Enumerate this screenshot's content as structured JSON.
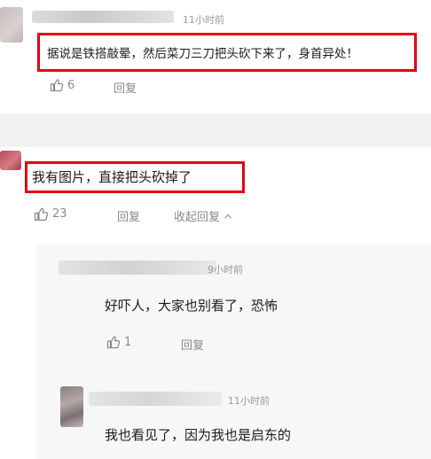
{
  "comment1": {
    "time": "11小时前",
    "text": "据说是铁搭敲晕，然后菜刀三刀把头砍下来了，身首异处！",
    "likes": "6",
    "reply_label": "回复"
  },
  "comment2": {
    "text": "我有图片，直接把头砍掉了",
    "likes": "23",
    "reply_label": "回复",
    "collapse_label": "收起回复",
    "replies": [
      {
        "time": "9小时前",
        "text": "好吓人，大家也别看了，恐怖",
        "likes": "1",
        "reply_label": "回复"
      },
      {
        "time": "11小时前",
        "text": "我也看见了，因为我也是启东的"
      }
    ]
  },
  "colors": {
    "highlight": "#e60012",
    "muted": "#888888",
    "time": "#999999"
  },
  "icons": {
    "like": "thumbs-up-icon",
    "collapse": "chevron-up-icon"
  }
}
